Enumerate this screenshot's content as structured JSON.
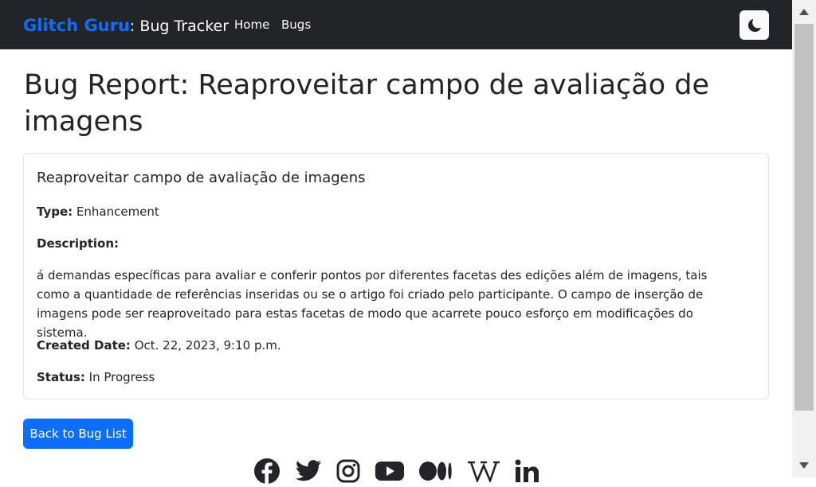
{
  "navbar": {
    "brand_name": "Glitch Guru",
    "brand_rest": ": Bug Tracker",
    "links": [
      "Home",
      "Bugs"
    ],
    "theme_toggle_icon": "moon-icon"
  },
  "page": {
    "title": "Bug Report: Reaproveitar campo de avaliação de imagens"
  },
  "card": {
    "title": "Reaproveitar campo de avaliação de imagens",
    "type_label": "Type:",
    "type_value": " Enhancement",
    "description_label": "Description:",
    "description": "á demandas específicas para avaliar e conferir pontos por diferentes facetas des edições além de imagens, tais como a quantidade de referências inseridas ou se o artigo foi criado pelo participante. O campo de inserção de imagens pode ser reaproveitado para estas facetas de modo que acarrete pouco esforço em modificações do sistema.",
    "created_label": "Created Date:",
    "created_value": " Oct. 22, 2023, 9:10 p.m.",
    "status_label": "Status:",
    "status_value": " In Progress"
  },
  "actions": {
    "back_label": "Back to Bug List"
  },
  "footer": {
    "social_icons": [
      "facebook-icon",
      "twitter-icon",
      "instagram-icon",
      "youtube-icon",
      "medium-icon",
      "wikipedia-icon",
      "linkedin-icon"
    ]
  },
  "colors": {
    "navbar_bg": "#212529",
    "brand_accent": "#0d6efd",
    "button_primary": "#0d6efd",
    "card_border": "#dee2e6"
  }
}
